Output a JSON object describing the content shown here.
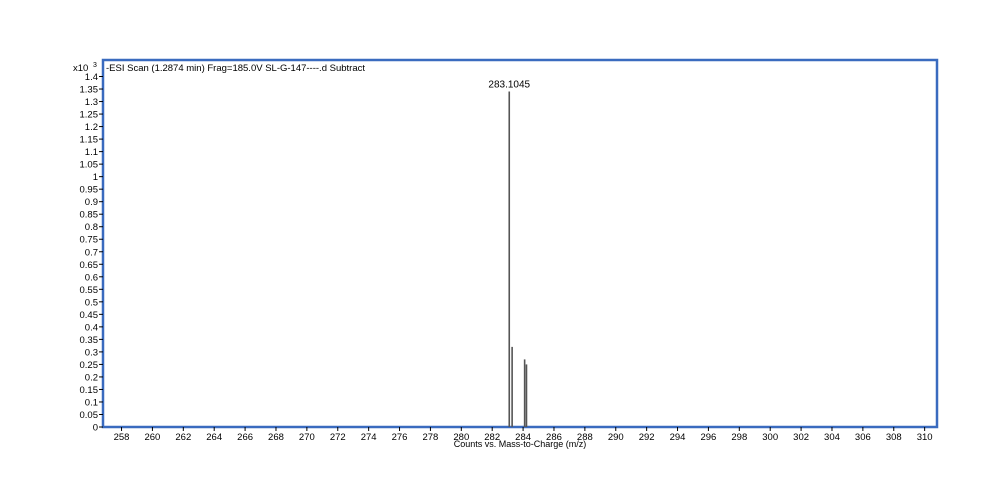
{
  "chart_data": {
    "type": "bar",
    "title": "-ESI Scan (1.2874 min) Frag=185.0V SL-G-147----.d  Subtract",
    "y_multiplier_label": "x10",
    "y_multiplier_exponent": "3",
    "xlabel": "Counts vs. Mass-to-Charge (m/z)",
    "ylabel": "",
    "xlim": [
      256.8,
      310.8
    ],
    "ylim": [
      0,
      1.43
    ],
    "x_ticks": [
      258,
      260,
      262,
      264,
      266,
      268,
      270,
      272,
      274,
      276,
      278,
      280,
      282,
      284,
      286,
      288,
      290,
      292,
      294,
      296,
      298,
      300,
      302,
      304,
      306,
      308,
      310
    ],
    "y_ticks": [
      0,
      0.05,
      0.1,
      0.15,
      0.2,
      0.25,
      0.3,
      0.35,
      0.4,
      0.45,
      0.5,
      0.55,
      0.6,
      0.65,
      0.7,
      0.75,
      0.8,
      0.85,
      0.9,
      0.95,
      1,
      1.05,
      1.1,
      1.15,
      1.2,
      1.25,
      1.3,
      1.35,
      1.4
    ],
    "y_tick_labels": [
      "0",
      "0.05",
      "0.1",
      "0.15",
      "0.2",
      "0.25",
      "0.3",
      "0.35",
      "0.4",
      "0.45",
      "0.5",
      "0.55",
      "0.6",
      "0.65",
      "0.7",
      "0.75",
      "0.8",
      "0.85",
      "0.9",
      "0.95",
      "1",
      "1.05",
      "1.1",
      "1.15",
      "1.2",
      "1.25",
      "1.3",
      "1.35",
      "1.4"
    ],
    "peaks": [
      {
        "mz": 283.1045,
        "intensity": 1.34,
        "label": "283.1045"
      },
      {
        "mz": 283.29,
        "intensity": 0.32,
        "label": ""
      },
      {
        "mz": 284.1,
        "intensity": 0.27,
        "label": ""
      },
      {
        "mz": 284.22,
        "intensity": 0.25,
        "label": ""
      }
    ],
    "grid": false,
    "colors": {
      "frame": "#3a6bbf",
      "peak": "#555555",
      "axis": "#000000"
    }
  }
}
